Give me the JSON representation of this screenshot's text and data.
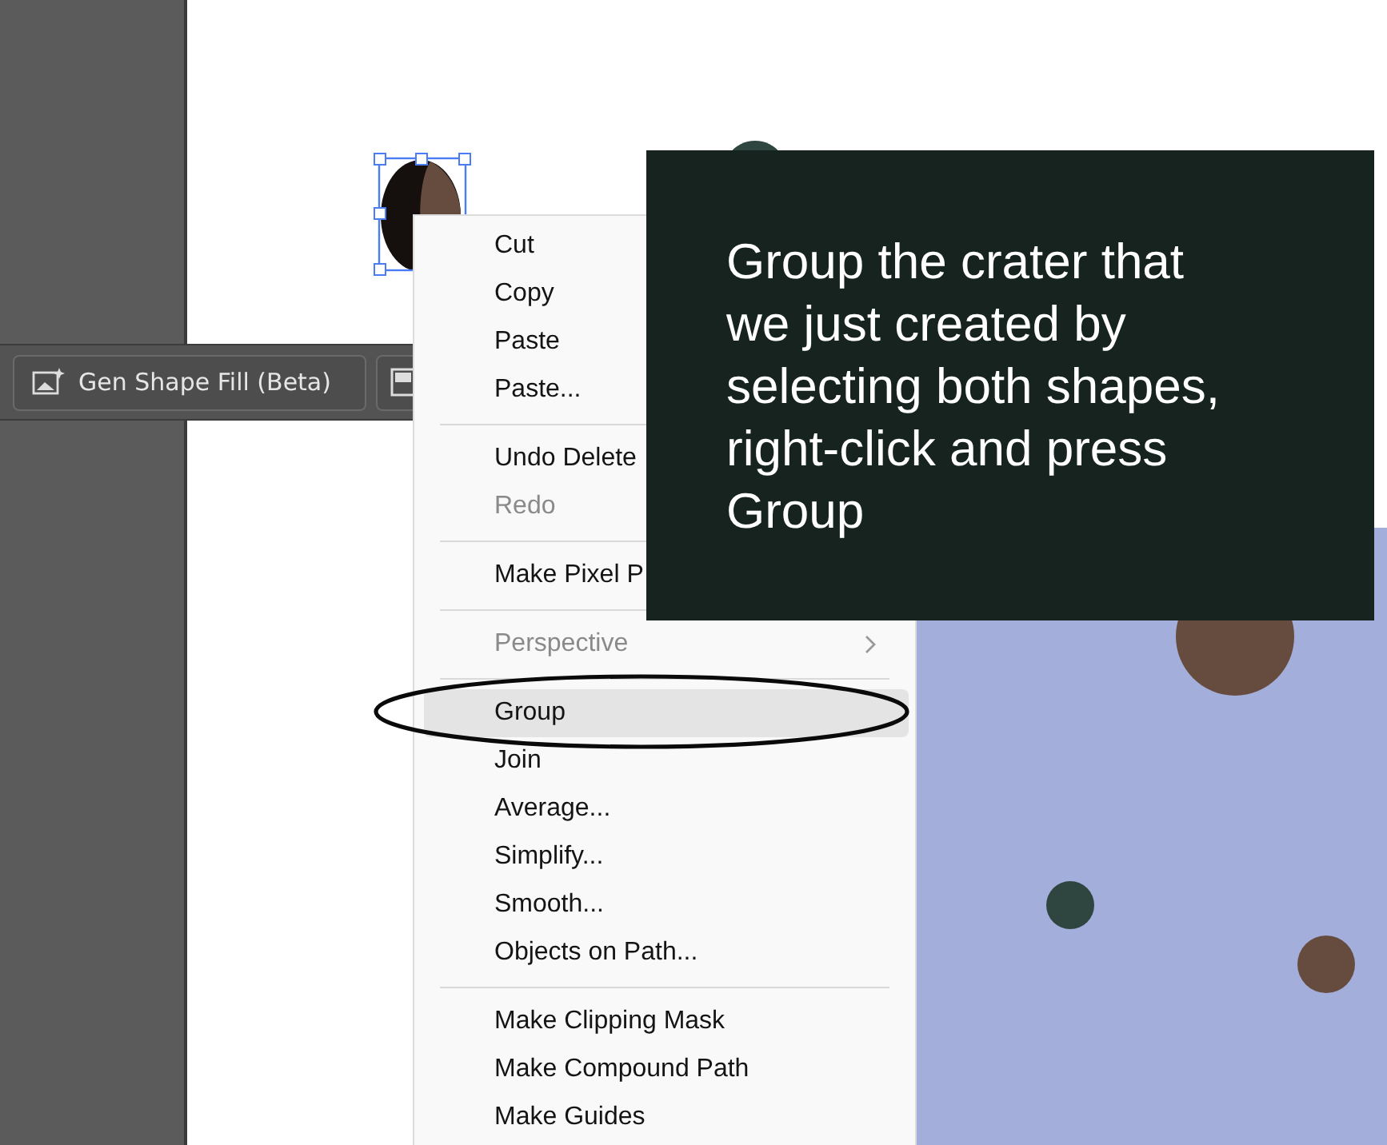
{
  "toolbar": {
    "buttons": [
      {
        "label": "Gen Shape Fill (Beta)"
      }
    ]
  },
  "context_menu": {
    "items": [
      {
        "kind": "item",
        "label": "Cut",
        "disabled": false,
        "selected": false
      },
      {
        "kind": "item",
        "label": "Copy",
        "disabled": false,
        "selected": false
      },
      {
        "kind": "item",
        "label": "Paste",
        "disabled": false,
        "selected": false
      },
      {
        "kind": "item",
        "label": "Paste...",
        "disabled": false,
        "selected": false
      },
      {
        "kind": "separator"
      },
      {
        "kind": "item",
        "label": "Undo Delete",
        "disabled": false,
        "selected": false
      },
      {
        "kind": "item",
        "label": "Redo",
        "disabled": true,
        "selected": false
      },
      {
        "kind": "separator"
      },
      {
        "kind": "item",
        "label": "Make Pixel P",
        "disabled": false,
        "selected": false
      },
      {
        "kind": "separator"
      },
      {
        "kind": "item",
        "label": "Perspective",
        "disabled": true,
        "selected": false,
        "submenu": true
      },
      {
        "kind": "separator"
      },
      {
        "kind": "item",
        "label": "Group",
        "disabled": false,
        "selected": true
      },
      {
        "kind": "item",
        "label": "Join",
        "disabled": false,
        "selected": false
      },
      {
        "kind": "item",
        "label": "Average...",
        "disabled": false,
        "selected": false
      },
      {
        "kind": "item",
        "label": "Simplify...",
        "disabled": false,
        "selected": false
      },
      {
        "kind": "item",
        "label": "Smooth...",
        "disabled": false,
        "selected": false
      },
      {
        "kind": "item",
        "label": "Objects on Path...",
        "disabled": false,
        "selected": false
      },
      {
        "kind": "separator"
      },
      {
        "kind": "item",
        "label": "Make Clipping Mask",
        "disabled": false,
        "selected": false
      },
      {
        "kind": "item",
        "label": "Make Compound Path",
        "disabled": false,
        "selected": false
      },
      {
        "kind": "item",
        "label": "Make Guides",
        "disabled": false,
        "selected": false
      }
    ]
  },
  "callout": {
    "text": "Group the crater that we just created by selecting both shapes, right-click and press Group"
  }
}
